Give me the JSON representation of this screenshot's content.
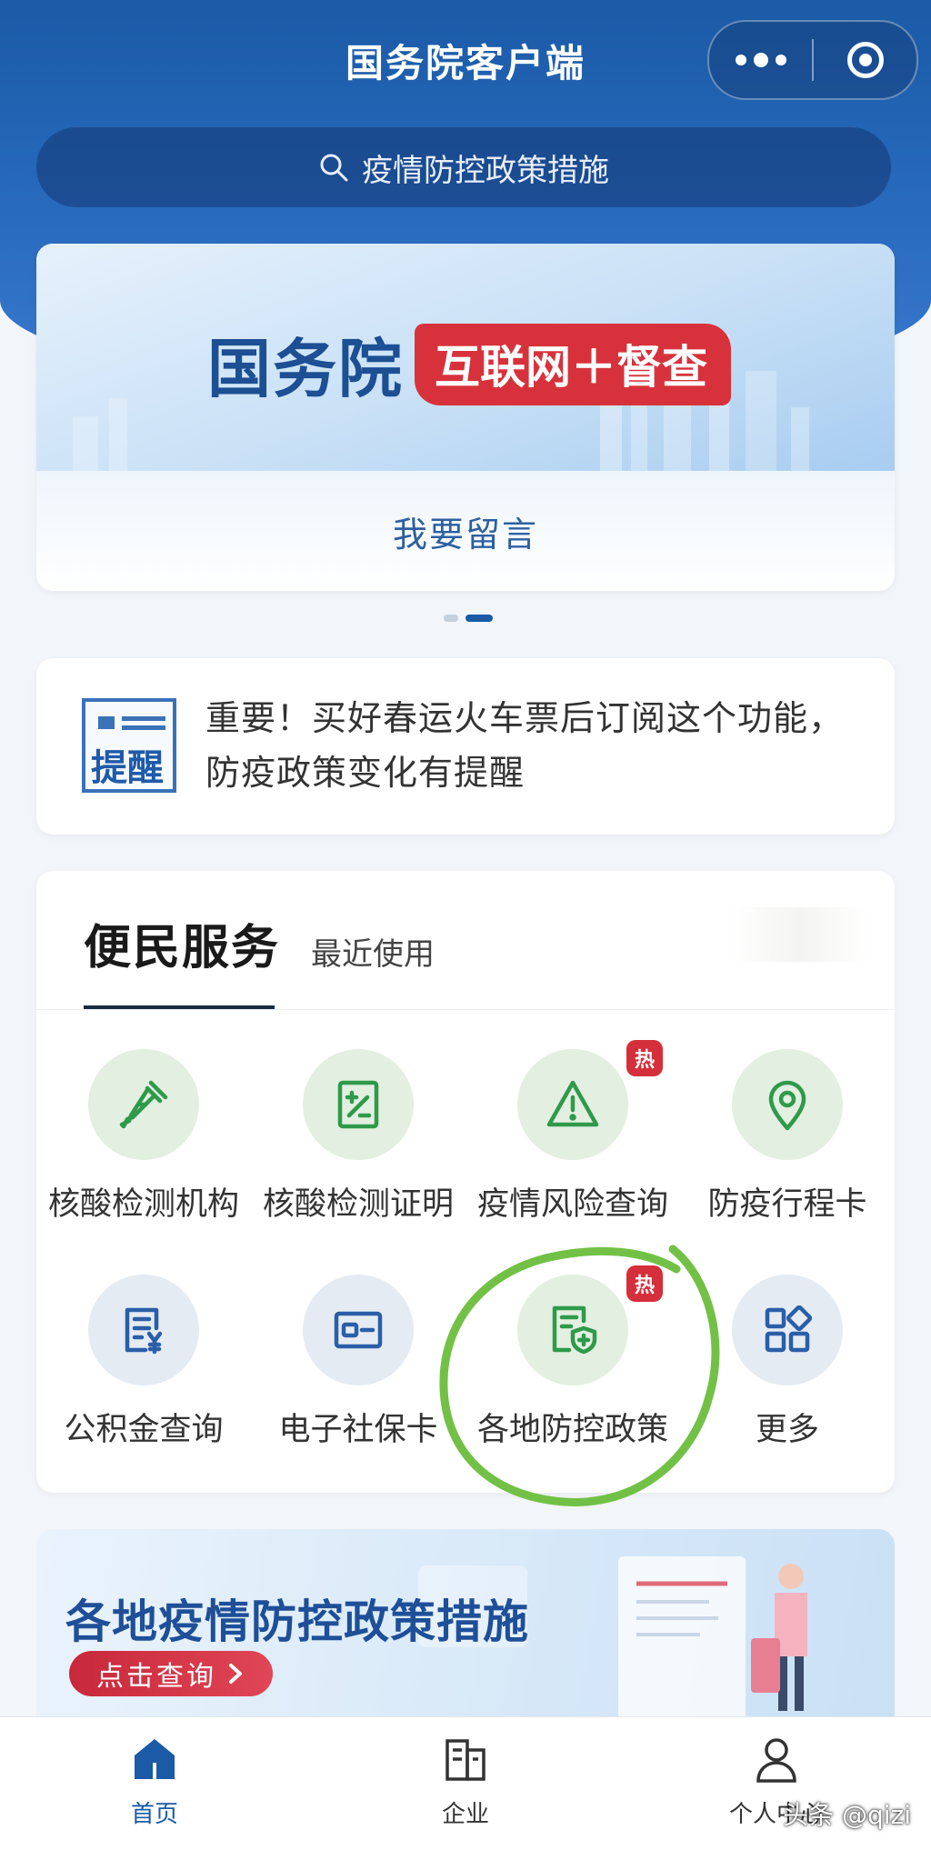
{
  "header": {
    "title": "国务院客户端"
  },
  "search": {
    "placeholder": "疫情防控政策措施"
  },
  "banner": {
    "brand": "国务院",
    "tag": "互联网＋督查",
    "link": "我要留言"
  },
  "notice": {
    "badge": "提醒",
    "text": "重要！买好春运火车票后订阅这个功能，防疫政策变化有提醒"
  },
  "services": {
    "tabs": [
      {
        "label": "便民服务",
        "active": true
      },
      {
        "label": "最近使用",
        "active": false
      }
    ],
    "items": [
      {
        "label": "核酸检测机构",
        "icon": "dropper-icon",
        "hot": ""
      },
      {
        "label": "核酸检测证明",
        "icon": "certificate-icon",
        "hot": ""
      },
      {
        "label": "疫情风险查询",
        "icon": "warning-icon",
        "hot": "热"
      },
      {
        "label": "防疫行程卡",
        "icon": "location-pin-icon",
        "hot": ""
      },
      {
        "label": "公积金查询",
        "icon": "fund-document-icon",
        "hot": ""
      },
      {
        "label": "电子社保卡",
        "icon": "id-card-icon",
        "hot": ""
      },
      {
        "label": "各地防控政策",
        "icon": "shield-document-icon",
        "hot": "热"
      },
      {
        "label": "更多",
        "icon": "grid-icon",
        "hot": ""
      }
    ]
  },
  "promo": {
    "title": "各地疫情防控政策措施",
    "button": "点击查询"
  },
  "tabbar": {
    "items": [
      {
        "label": "首页",
        "active": true,
        "icon": "home-icon"
      },
      {
        "label": "企业",
        "active": false,
        "icon": "building-icon"
      },
      {
        "label": "个人中心",
        "active": false,
        "icon": "user-icon"
      }
    ]
  },
  "watermark": "头条 @qizi",
  "colors": {
    "brand_blue": "#1a5aa6",
    "hot_red": "#d42f3a",
    "icon_green": "#2e9a4a",
    "icon_blue": "#2a5ea8",
    "annotation_green": "#72c146"
  }
}
